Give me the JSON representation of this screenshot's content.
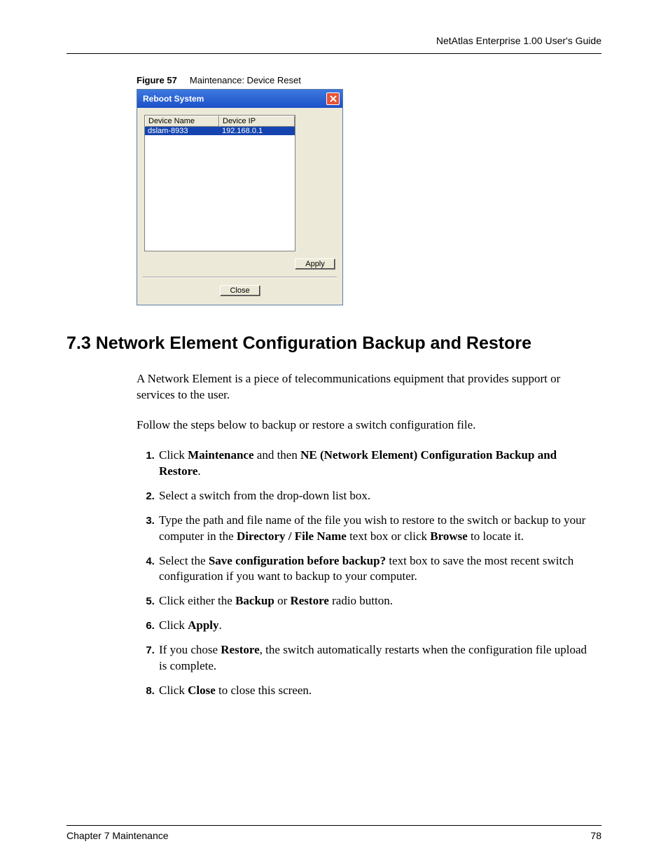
{
  "header": {
    "text": "NetAtlas Enterprise 1.00 User's Guide"
  },
  "figure": {
    "label": "Figure 57",
    "caption": "Maintenance: Device Reset"
  },
  "dialog": {
    "title": "Reboot System",
    "columns": {
      "name": "Device Name",
      "ip": "Device IP"
    },
    "row": {
      "name": "dslam-8933",
      "ip": "192.168.0.1"
    },
    "apply": "Apply",
    "close": "Close"
  },
  "section": {
    "heading": "7.3  Network Element Configuration Backup and Restore",
    "p1": "A Network Element is a piece of telecommunications equipment that provides support or services to the user.",
    "p2": "Follow the steps below to backup or restore a switch configuration file."
  },
  "steps": {
    "s1a": "Click ",
    "s1b": "Maintenance",
    "s1c": " and then ",
    "s1d": "NE (Network Element) Configuration Backup and Restore",
    "s1e": ".",
    "s2": "Select a switch from the drop-down list box.",
    "s3a": "Type the path and file name of the file you wish to restore to the switch or backup to your computer in the ",
    "s3b": "Directory / File Name",
    "s3c": " text box or click ",
    "s3d": "Browse",
    "s3e": " to locate it.",
    "s4a": "Select the ",
    "s4b": "Save configuration before backup?",
    "s4c": " text box to save the most recent switch configuration if you want to backup to your computer.",
    "s5a": "Click either the ",
    "s5b": "Backup",
    "s5c": " or ",
    "s5d": "Restore",
    "s5e": " radio button.",
    "s6a": "Click ",
    "s6b": "Apply",
    "s6c": ".",
    "s7a": "If you chose ",
    "s7b": "Restore",
    "s7c": ", the switch automatically restarts when the configuration file upload is complete.",
    "s8a": "Click ",
    "s8b": "Close",
    "s8c": " to close this screen."
  },
  "footer": {
    "left": "Chapter 7 Maintenance",
    "right": "78"
  }
}
